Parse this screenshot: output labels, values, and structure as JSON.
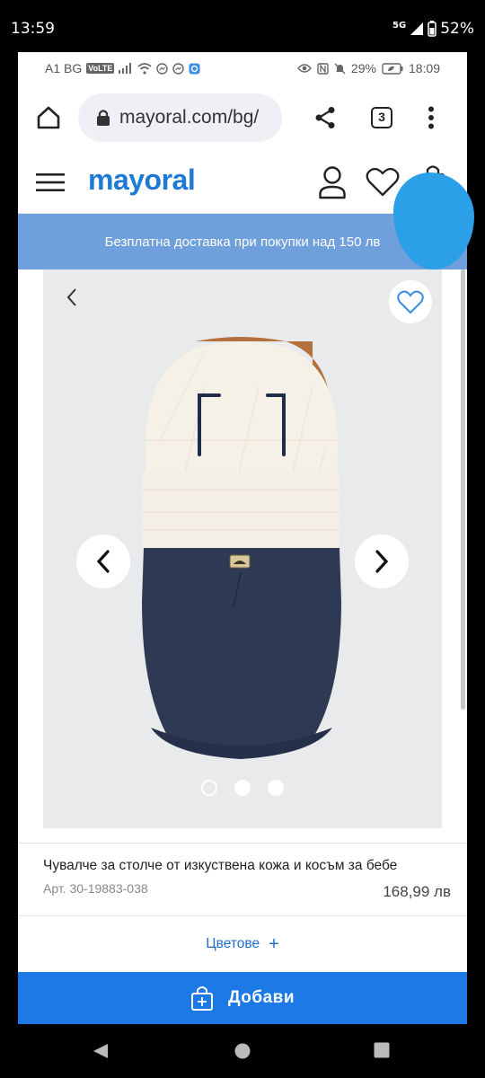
{
  "outer_status": {
    "time": "13:59",
    "network": "5G",
    "battery": "52%"
  },
  "inner_status": {
    "carrier": "A1 BG",
    "volte": "VoLTE",
    "battery": "29%",
    "time": "18:09"
  },
  "browser": {
    "url": "mayoral.com/bg/",
    "tab_count": "3"
  },
  "site": {
    "logo": "mayoral",
    "brand_color": "#1f7ad6"
  },
  "promo": {
    "text": "Безплатна доставка при покупки над 150 лв"
  },
  "gallery": {
    "slide_count": 3,
    "active_slide": 1
  },
  "product": {
    "title": "Чувалче за столче от изкуствена кожа и косъм за бебе",
    "reference": "Арт. 30-19883-038",
    "price": "168,99 лв"
  },
  "colors": {
    "label": "Цветове",
    "plus": "+"
  },
  "add_button": {
    "label": "Добави"
  },
  "icons": {
    "home": "home-icon",
    "lock": "lock-icon",
    "share": "share-icon",
    "menu": "more-vert-icon",
    "hamburger": "hamburger-icon",
    "user": "user-icon",
    "heart": "heart-icon",
    "bag": "bag-icon",
    "back": "back-nav-icon",
    "home_nav": "home-nav-icon",
    "recents": "recents-nav-icon"
  }
}
